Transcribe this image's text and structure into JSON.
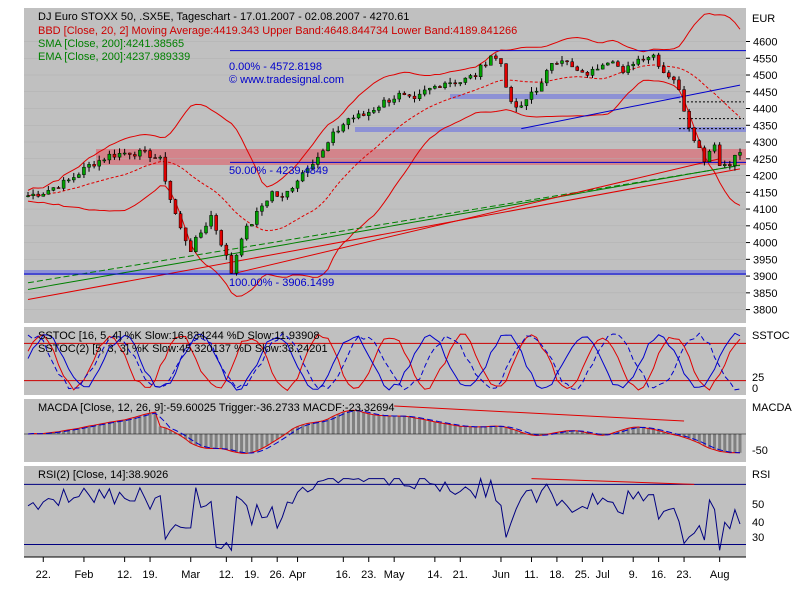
{
  "chart_data": {
    "type": "line",
    "instrument": "DJ Euro STOXX 50",
    "header": {
      "title": "DJ Euro STOXX 50, .SX5E, Tageschart - 17.01.2007 - 02.08.2007 - 4270.61",
      "bbd": "BBD [Close, 20, 2] Moving Average:4419.343 Upper Band:4648.844734 Lower Band:4189.841266",
      "sma": "SMA [Close, 200]:4241.38565",
      "ema": "EMA [Close, 200]:4237.989339",
      "currency": "EUR"
    },
    "watermark": "© www.tradesignal.com",
    "fib_labels": [
      "0.00% - 4572.8198",
      "50.00% - 4239.4849",
      "100.00% - 3906.1499"
    ],
    "price_axis": {
      "ylim": [
        3760,
        4700
      ],
      "ticks": [
        3800,
        3850,
        3900,
        3950,
        4000,
        4050,
        4100,
        4150,
        4200,
        4250,
        4300,
        4350,
        4400,
        4450,
        4500,
        4550,
        4600
      ]
    },
    "x_axis": {
      "n_bars": 141,
      "ticks": [
        {
          "label": "22.",
          "bar": 3
        },
        {
          "label": "Feb",
          "bar": 11
        },
        {
          "label": "12.",
          "bar": 19
        },
        {
          "label": "19.",
          "bar": 24
        },
        {
          "label": "Mar",
          "bar": 32
        },
        {
          "label": "12.",
          "bar": 39
        },
        {
          "label": "19.",
          "bar": 44
        },
        {
          "label": "26.",
          "bar": 49
        },
        {
          "label": "Apr",
          "bar": 53
        },
        {
          "label": "16.",
          "bar": 62
        },
        {
          "label": "23.",
          "bar": 67
        },
        {
          "label": "May",
          "bar": 72
        },
        {
          "label": "14.",
          "bar": 80
        },
        {
          "label": "21.",
          "bar": 85
        },
        {
          "label": "Jun",
          "bar": 93
        },
        {
          "label": "11.",
          "bar": 99
        },
        {
          "label": "18.",
          "bar": 104
        },
        {
          "label": "25.",
          "bar": 109
        },
        {
          "label": "Jul",
          "bar": 113
        },
        {
          "label": "9.",
          "bar": 119
        },
        {
          "label": "16.",
          "bar": 124
        },
        {
          "label": "23.",
          "bar": 129
        },
        {
          "label": "Aug",
          "bar": 136
        }
      ]
    },
    "price_keypoints": [
      [
        0,
        4140
      ],
      [
        3,
        4150
      ],
      [
        8,
        4185
      ],
      [
        12,
        4230
      ],
      [
        16,
        4260
      ],
      [
        20,
        4270
      ],
      [
        24,
        4262
      ],
      [
        26,
        4245
      ],
      [
        27,
        4190
      ],
      [
        28,
        4130
      ],
      [
        30,
        4040
      ],
      [
        32,
        3980
      ],
      [
        34,
        4030
      ],
      [
        36,
        4080
      ],
      [
        38,
        4000
      ],
      [
        40,
        3912
      ],
      [
        42,
        4020
      ],
      [
        44,
        4060
      ],
      [
        46,
        4110
      ],
      [
        48,
        4150
      ],
      [
        50,
        4130
      ],
      [
        52,
        4170
      ],
      [
        55,
        4230
      ],
      [
        58,
        4270
      ],
      [
        60,
        4320
      ],
      [
        63,
        4370
      ],
      [
        66,
        4380
      ],
      [
        70,
        4420
      ],
      [
        73,
        4440
      ],
      [
        76,
        4420
      ],
      [
        78,
        4450
      ],
      [
        82,
        4480
      ],
      [
        85,
        4480
      ],
      [
        88,
        4500
      ],
      [
        91,
        4560
      ],
      [
        93,
        4535
      ],
      [
        95,
        4410
      ],
      [
        97,
        4400
      ],
      [
        99,
        4450
      ],
      [
        101,
        4470
      ],
      [
        103,
        4540
      ],
      [
        105,
        4550
      ],
      [
        107,
        4520
      ],
      [
        109,
        4500
      ],
      [
        111,
        4510
      ],
      [
        113,
        4540
      ],
      [
        115,
        4550
      ],
      [
        117,
        4500
      ],
      [
        119,
        4540
      ],
      [
        121,
        4555
      ],
      [
        123,
        4560
      ],
      [
        125,
        4510
      ],
      [
        127,
        4490
      ],
      [
        128,
        4450
      ],
      [
        130,
        4350
      ],
      [
        132,
        4280
      ],
      [
        133,
        4250
      ],
      [
        135,
        4300
      ],
      [
        136,
        4230
      ],
      [
        138,
        4240
      ],
      [
        140,
        4270
      ]
    ],
    "horizontal_levels": [
      4572.82,
      4239.48,
      3906.15
    ],
    "stoch": {
      "label_1": "SSTOC [16, 5, 4] %K Slow:16.834244 %D Slow:11.93908",
      "label_2": "SSTOC(2) [5, 3, 3] %K Slow:45.320137 %D Slow:33.24201",
      "axis_title": "SSTOC",
      "ticks": [
        25,
        0
      ]
    },
    "macd": {
      "label": "MACDA [Close, 12, 26, 9]:-59.60025 Trigger:-36.2733 MACDF:-23.32694",
      "axis_title": "MACDA",
      "ticks": [
        -50
      ]
    },
    "rsi": {
      "label": "RSI(2) [Close, 14]:38.9026",
      "axis_title": "RSI",
      "ticks": [
        50,
        40,
        30
      ],
      "ylim": [
        20,
        80
      ]
    }
  }
}
